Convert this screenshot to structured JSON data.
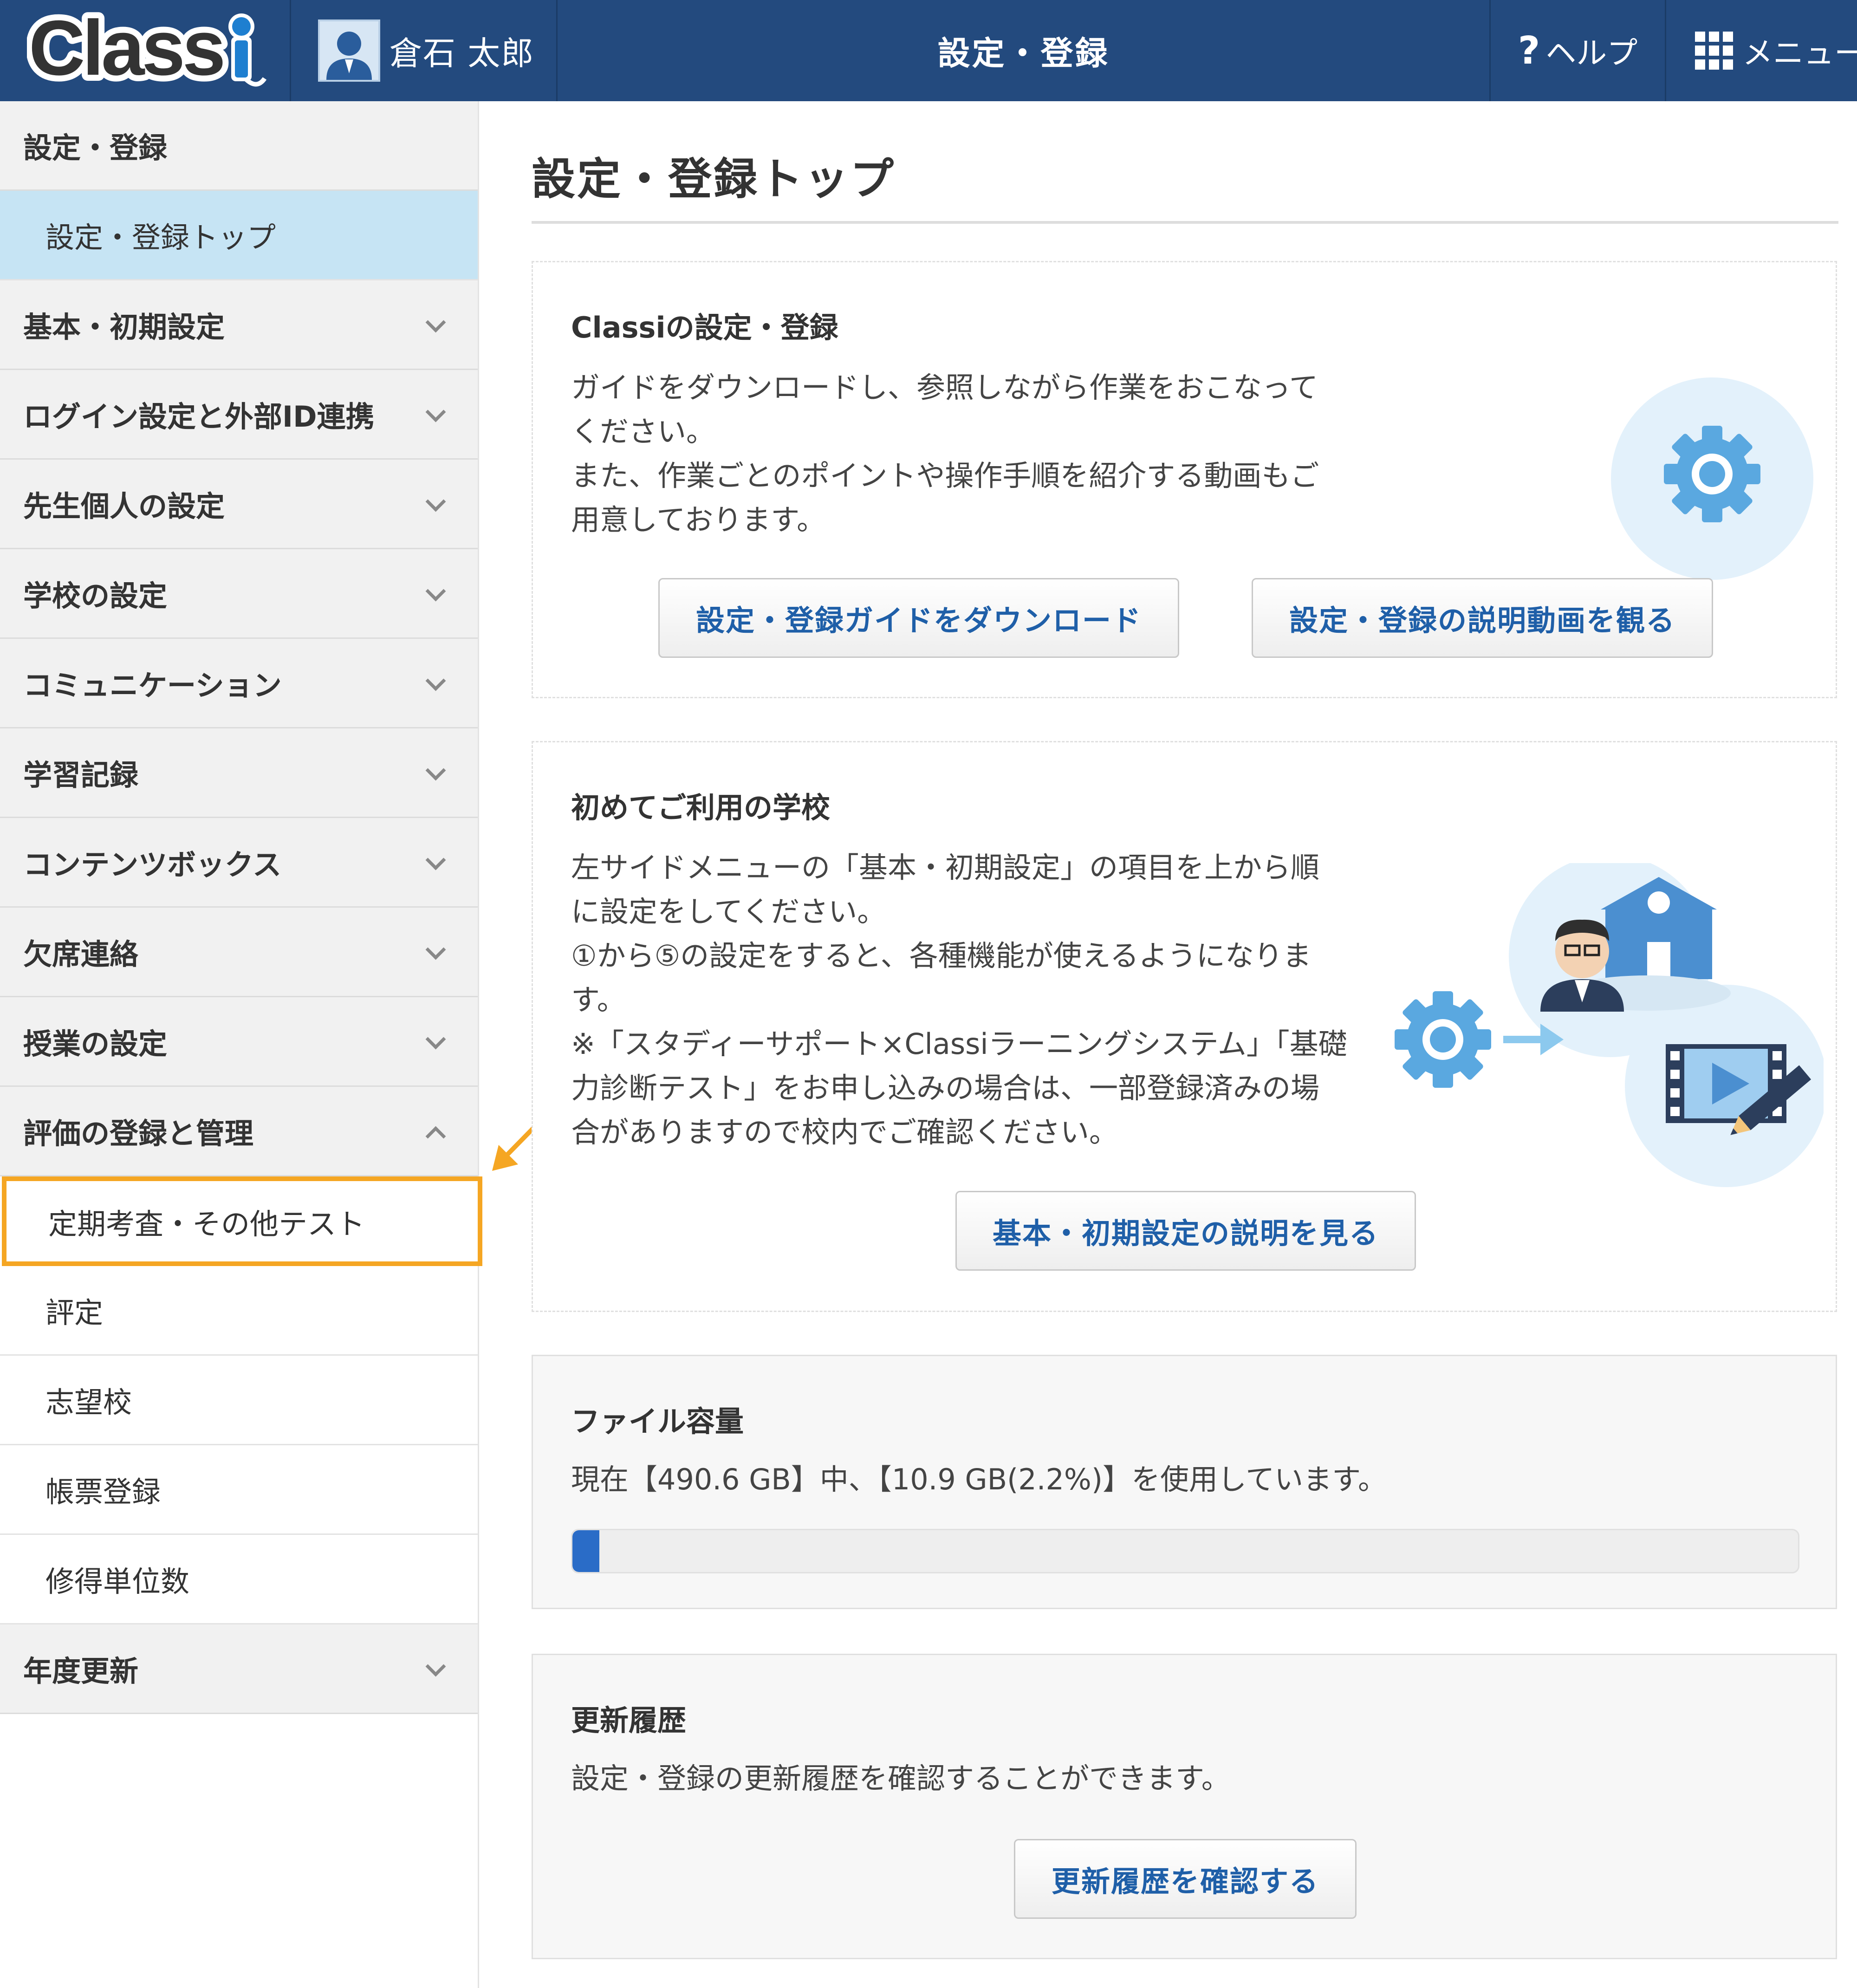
{
  "header": {
    "logo_text": "Classi",
    "user_name": "倉石 太郎",
    "title": "設定・登録",
    "help_label": "ヘルプ",
    "help_icon": "question-icon",
    "menu_label": "メニュー",
    "menu_icon": "grid-icon",
    "brand_color": "#234a7e"
  },
  "sidebar": {
    "section_title": "設定・登録",
    "top_item": "設定・登録トップ",
    "groups": [
      {
        "label": "基本・初期設定"
      },
      {
        "label": "ログイン設定と外部ID連携"
      },
      {
        "label": "先生個人の設定"
      },
      {
        "label": "学校の設定"
      },
      {
        "label": "コミュニケーション"
      },
      {
        "label": "学習記録"
      },
      {
        "label": "コンテンツボックス"
      },
      {
        "label": "欠席連絡"
      },
      {
        "label": "授業の設定"
      },
      {
        "label": "評価の登録と管理"
      }
    ],
    "eval_sub_items": [
      {
        "label": "定期考査・その他テスト"
      },
      {
        "label": "評定"
      },
      {
        "label": "志望校"
      },
      {
        "label": "帳票登録"
      },
      {
        "label": "修得単位数"
      }
    ],
    "last_group": "年度更新",
    "active_color": "#c6e4f4",
    "highlight_color": "#f5a623"
  },
  "main": {
    "page_title": "設定・登録トップ",
    "card1": {
      "title": "Classiの設定・登録",
      "lines": [
        "ガイドをダウンロードし、参照しながら作業をおこなって",
        "ください。",
        "また、作業ごとのポイントや操作手順を紹介する動画もご",
        "用意しております。"
      ],
      "btn_guide": "設定・登録ガイドをダウンロード",
      "btn_video": "設定・登録の説明動画を観る"
    },
    "card2": {
      "title": "初めてご利用の学校",
      "lines": [
        "左サイドメニューの「基本・初期設定」の項目を上から順",
        "に設定をしてください。",
        "①から⑤の設定をすると、各種機能が使えるようになりま",
        "す。",
        "※「スタディーサポート×Classiラーニングシステム」「基礎",
        "力診断テスト」をお申し込みの場合は、一部登録済みの場",
        "合がありますので校内でご確認ください。"
      ],
      "btn_basic": "基本・初期設定の説明を見る"
    },
    "card3": {
      "title": "ファイル容量",
      "usage_text": "現在【490.6 GB】中、【10.9 GB(2.2%)】を使用しています。",
      "usage_percent": 2.2
    },
    "card4": {
      "title": "更新履歴",
      "text": "設定・登録の更新履歴を確認することができます。",
      "btn_history": "更新履歴を確認する"
    }
  }
}
